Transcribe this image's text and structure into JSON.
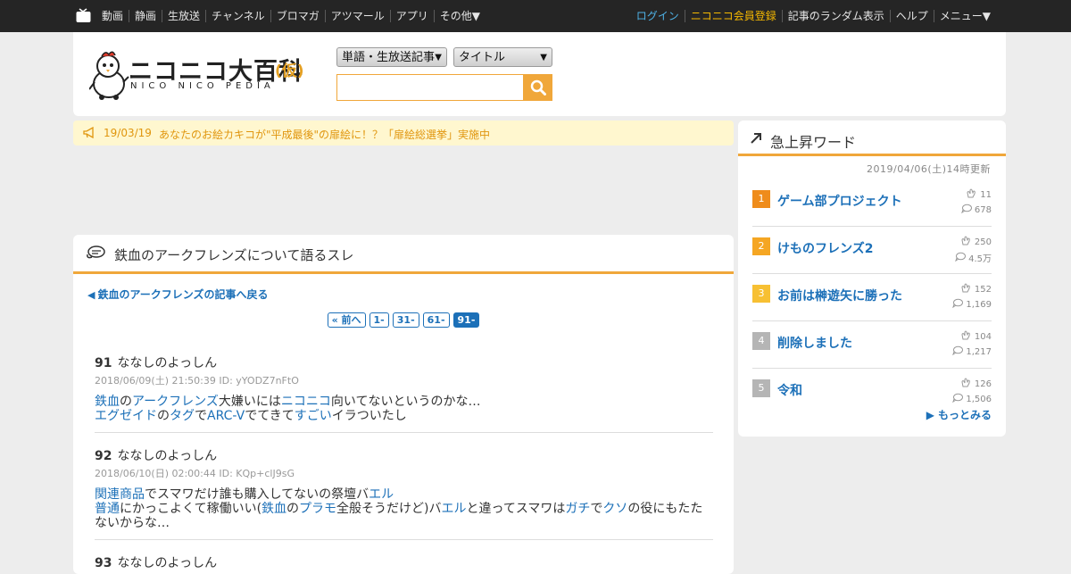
{
  "topnav": {
    "left": [
      "動画",
      "静画",
      "生放送",
      "チャンネル",
      "ブロマガ",
      "アツマール",
      "アプリ",
      "その他▼"
    ],
    "right": {
      "login": "ログイン",
      "register": "ニコニコ会員登録",
      "random": "記事のランダム表示",
      "help": "ヘルプ",
      "menu": "メニュー▼"
    }
  },
  "logo": {
    "title": "ニコニコ大百科",
    "kakko": "(仮)",
    "sub": "NICO NICO PEDIA"
  },
  "search": {
    "type_select": "単語・生放送記事",
    "target_select": "タイトル",
    "query": ""
  },
  "announcement": {
    "date": "19/03/19",
    "text": "あなたのお絵カキコが\"平成最後\"の扉絵に！？「扉絵総選挙」実施中"
  },
  "thread": {
    "title": "鉄血のアークフレンズについて語るスレ",
    "back_link": "鉄血のアークフレンズの記事へ戻る",
    "pages": [
      "« 前へ",
      "1-",
      "31-",
      "61-",
      "91-"
    ],
    "active_page": 4,
    "posts": [
      {
        "num": "91",
        "name": "ななしのよっしん",
        "meta": "2018/06/09(土) 21:50:39 ID: yYODZ7nFtO",
        "lines": [
          [
            {
              "t": "鉄血",
              "l": true
            },
            {
              "t": "の",
              "l": false
            },
            {
              "t": "アークフレンズ",
              "l": true
            },
            {
              "t": "大嫌いには",
              "l": false
            },
            {
              "t": "ニコニコ",
              "l": true
            },
            {
              "t": "向いてないというのかな…",
              "l": false
            }
          ],
          [
            {
              "t": "エグゼイド",
              "l": true
            },
            {
              "t": "の",
              "l": false
            },
            {
              "t": "タグ",
              "l": true
            },
            {
              "t": "で",
              "l": false
            },
            {
              "t": "ARC-V",
              "l": true
            },
            {
              "t": "でてきて",
              "l": false
            },
            {
              "t": "すごい",
              "l": true
            },
            {
              "t": "イラついたし",
              "l": false
            }
          ]
        ]
      },
      {
        "num": "92",
        "name": "ななしのよっしん",
        "meta": "2018/06/10(日) 02:00:44 ID: KQp+clJ9sG",
        "lines": [
          [
            {
              "t": "関連商品",
              "l": true
            },
            {
              "t": "でスマワだけ誰も購入してないの祭壇バ",
              "l": false
            },
            {
              "t": "エル",
              "l": true
            }
          ],
          [
            {
              "t": "普通",
              "l": true
            },
            {
              "t": "にかっこよくて稼働いい(",
              "l": false
            },
            {
              "t": "鉄血",
              "l": true
            },
            {
              "t": "の",
              "l": false
            },
            {
              "t": "プラモ",
              "l": true
            },
            {
              "t": "全般そうだけど)バ",
              "l": false
            },
            {
              "t": "エル",
              "l": true
            },
            {
              "t": "と違ってスマワは",
              "l": false
            },
            {
              "t": "ガチ",
              "l": true
            },
            {
              "t": "で",
              "l": false
            },
            {
              "t": "クソ",
              "l": true
            },
            {
              "t": "の役にもたた",
              "l": false
            }
          ],
          [
            {
              "t": "ないからな…",
              "l": false
            }
          ]
        ]
      },
      {
        "num": "93",
        "name": "ななしのよっしん",
        "meta": "",
        "lines": []
      }
    ]
  },
  "trending": {
    "title": "急上昇ワード",
    "updated": "2019/04/06(土)14時更新",
    "items": [
      {
        "rank": "1",
        "word": "ゲーム部プロジェクト",
        "stat_a": "11",
        "stat_b": "678",
        "color": "#ef8c1b"
      },
      {
        "rank": "2",
        "word": "けものフレンズ2",
        "stat_a": "250",
        "stat_b": "4.5万",
        "color": "#f5a623"
      },
      {
        "rank": "3",
        "word": "お前は榊遊矢に勝った",
        "stat_a": "152",
        "stat_b": "1,169",
        "color": "#f7c033"
      },
      {
        "rank": "4",
        "word": "削除しました",
        "stat_a": "104",
        "stat_b": "1,217",
        "color": "#b5b5b5"
      },
      {
        "rank": "5",
        "word": "令和",
        "stat_a": "126",
        "stat_b": "1,506",
        "color": "#b5b5b5"
      }
    ],
    "more": "もっとみる"
  },
  "colors": {
    "accent": "#f0a73a",
    "link": "#1c70b8",
    "topbar": "#252525",
    "background": "#ededed"
  }
}
